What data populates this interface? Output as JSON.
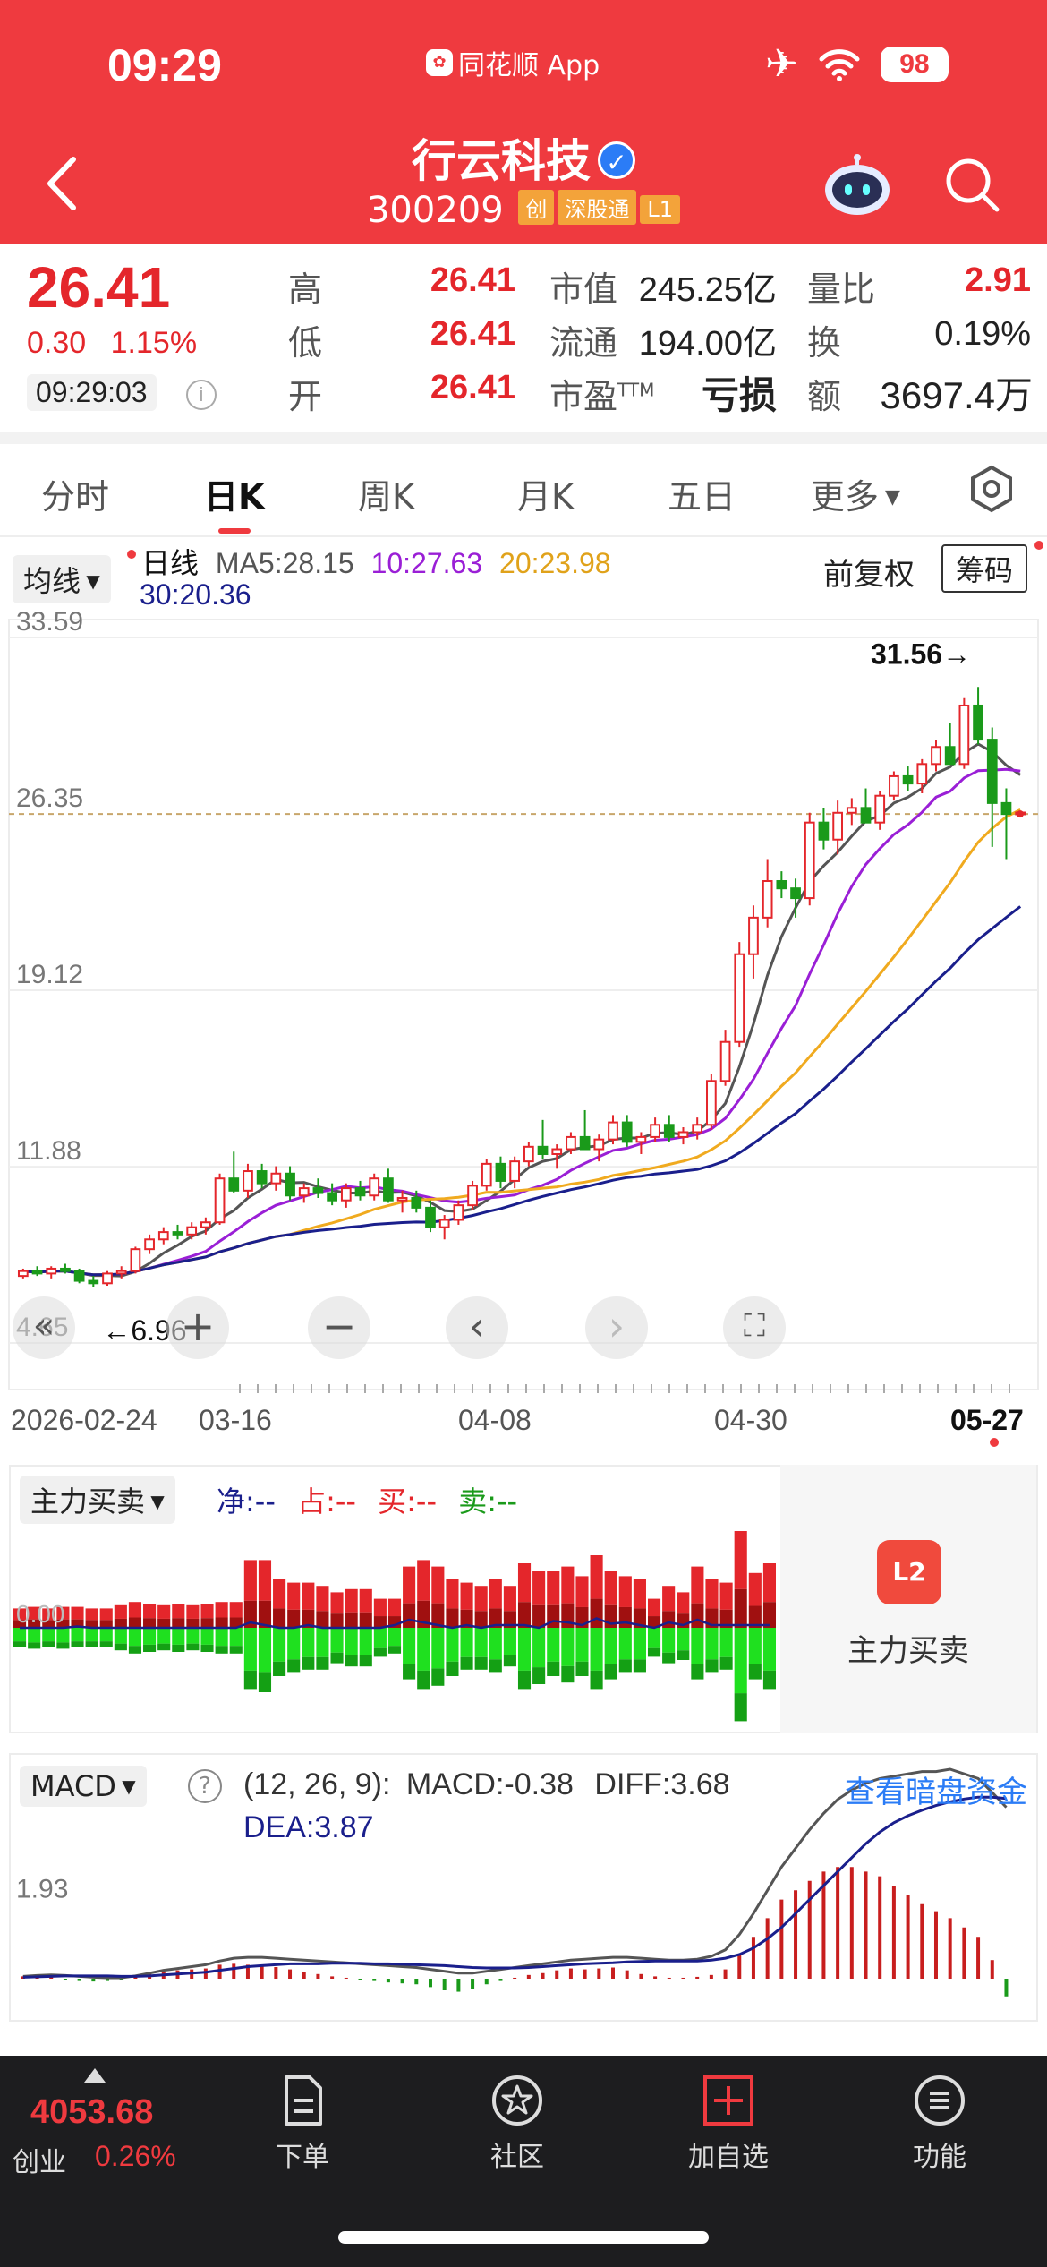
{
  "status": {
    "time": "09:29",
    "app": "同花顺 App",
    "battery": "98"
  },
  "stock": {
    "name": "行云科技",
    "code": "300209",
    "tags": [
      "创",
      "深股通",
      "L1"
    ]
  },
  "quote": {
    "price": "26.41",
    "change": "0.30",
    "pct": "1.15%",
    "time": "09:29:03",
    "rows": [
      {
        "l1": "高",
        "v1": "26.41",
        "l2": "市值",
        "v2": "245.25亿",
        "l3": "量比",
        "v3": "2.91"
      },
      {
        "l1": "低",
        "v1": "26.41",
        "l2": "流通",
        "v2": "194.00亿",
        "l3": "换",
        "v3": "0.19%"
      },
      {
        "l1": "开",
        "v1": "26.41",
        "l2": "市盈",
        "v2": "亏损",
        "l3": "额",
        "v3": "3697.4万"
      }
    ],
    "pe_sup": "TTM"
  },
  "tabs": [
    "分时",
    "日K",
    "周K",
    "月K",
    "五日",
    "更多"
  ],
  "ma": {
    "button": "均线",
    "period": "日线",
    "ma5": "MA5:28.15",
    "ma10": "10:27.63",
    "ma20": "20:23.98",
    "ma30": "30:20.36",
    "adjust": "前复权",
    "chips": "筹码"
  },
  "colors": {
    "up": "#e4262b",
    "down": "#1a9a1a",
    "ma5": "#555555",
    "ma10": "#9a1fd6",
    "ma20": "#f0aa1f",
    "ma30": "#1a1f8c",
    "brand": "#ef3a3f"
  },
  "chart_data": [
    {
      "type": "candlestick",
      "title": "",
      "y_ticks": [
        "33.59",
        "26.35",
        "19.12",
        "11.88",
        "4.65"
      ],
      "ylim": [
        4.65,
        33.59
      ],
      "current_price": 26.35,
      "high_marker": "31.56→",
      "low_marker": "←6.96",
      "x_labels": [
        "2026-02-24",
        "03-16",
        "04-08",
        "04-30",
        "05-27"
      ],
      "candles": [
        [
          7.4,
          7.7,
          7.3,
          7.6
        ],
        [
          7.6,
          7.8,
          7.4,
          7.5
        ],
        [
          7.5,
          7.8,
          7.3,
          7.7
        ],
        [
          7.7,
          7.9,
          7.5,
          7.6
        ],
        [
          7.6,
          7.7,
          7.1,
          7.2
        ],
        [
          7.2,
          7.4,
          6.96,
          7.1
        ],
        [
          7.1,
          7.6,
          7.0,
          7.5
        ],
        [
          7.5,
          7.8,
          7.3,
          7.6
        ],
        [
          7.6,
          8.6,
          7.5,
          8.5
        ],
        [
          8.5,
          9.1,
          8.3,
          8.9
        ],
        [
          8.9,
          9.4,
          8.7,
          9.2
        ],
        [
          9.2,
          9.5,
          8.9,
          9.1
        ],
        [
          9.1,
          9.6,
          8.9,
          9.4
        ],
        [
          9.4,
          9.8,
          9.1,
          9.6
        ],
        [
          9.6,
          11.6,
          9.5,
          11.4
        ],
        [
          11.4,
          12.5,
          10.8,
          10.9
        ],
        [
          10.9,
          12.0,
          10.6,
          11.7
        ],
        [
          11.7,
          12.0,
          11.0,
          11.2
        ],
        [
          11.2,
          11.9,
          10.9,
          11.6
        ],
        [
          11.6,
          11.9,
          10.5,
          10.7
        ],
        [
          10.7,
          11.2,
          10.4,
          11.0
        ],
        [
          11.0,
          11.4,
          10.6,
          10.8
        ],
        [
          10.8,
          11.2,
          10.3,
          10.5
        ],
        [
          10.5,
          11.2,
          10.2,
          11.0
        ],
        [
          11.0,
          11.3,
          10.5,
          10.7
        ],
        [
          10.7,
          11.6,
          10.5,
          11.4
        ],
        [
          11.4,
          11.8,
          10.4,
          10.5
        ],
        [
          10.5,
          10.9,
          10.0,
          10.6
        ],
        [
          10.6,
          10.9,
          10.0,
          10.2
        ],
        [
          10.2,
          10.5,
          9.2,
          9.4
        ],
        [
          9.4,
          9.9,
          8.9,
          9.7
        ],
        [
          9.7,
          10.5,
          9.5,
          10.3
        ],
        [
          10.3,
          11.3,
          10.1,
          11.1
        ],
        [
          11.1,
          12.2,
          10.9,
          12.0
        ],
        [
          12.0,
          12.3,
          11.0,
          11.3
        ],
        [
          11.3,
          12.3,
          11.0,
          12.1
        ],
        [
          12.1,
          12.9,
          11.9,
          12.7
        ],
        [
          12.7,
          13.8,
          12.2,
          12.4
        ],
        [
          12.4,
          12.8,
          11.8,
          12.6
        ],
        [
          12.6,
          13.3,
          12.4,
          13.1
        ],
        [
          13.1,
          14.2,
          12.8,
          12.6
        ],
        [
          12.6,
          13.2,
          12.1,
          13.0
        ],
        [
          13.0,
          14.0,
          12.8,
          13.7
        ],
        [
          13.7,
          14.0,
          12.7,
          12.9
        ],
        [
          12.9,
          13.3,
          12.4,
          13.1
        ],
        [
          13.1,
          13.9,
          12.9,
          13.6
        ],
        [
          13.6,
          14.0,
          12.9,
          13.1
        ],
        [
          13.1,
          13.5,
          12.8,
          13.3
        ],
        [
          13.3,
          13.9,
          13.0,
          13.6
        ],
        [
          13.6,
          15.7,
          13.4,
          15.4
        ],
        [
          15.4,
          17.5,
          15.2,
          17.0
        ],
        [
          17.0,
          21.1,
          16.8,
          20.6
        ],
        [
          20.6,
          22.6,
          19.6,
          22.1
        ],
        [
          22.1,
          24.5,
          21.7,
          23.6
        ],
        [
          23.6,
          24.0,
          22.9,
          23.3
        ],
        [
          23.3,
          23.7,
          22.1,
          22.9
        ],
        [
          22.9,
          26.4,
          22.6,
          26.0
        ],
        [
          26.0,
          26.6,
          24.9,
          25.3
        ],
        [
          25.3,
          26.9,
          24.7,
          26.4
        ],
        [
          26.4,
          27.0,
          25.9,
          26.6
        ],
        [
          26.6,
          27.4,
          26.1,
          26.0
        ],
        [
          26.0,
          27.3,
          25.7,
          27.1
        ],
        [
          27.1,
          28.1,
          26.9,
          27.9
        ],
        [
          27.9,
          28.3,
          27.3,
          27.6
        ],
        [
          27.6,
          28.6,
          27.2,
          28.4
        ],
        [
          28.4,
          29.4,
          28.1,
          29.1
        ],
        [
          29.1,
          30.1,
          28.4,
          28.4
        ],
        [
          28.4,
          31.1,
          28.2,
          30.8
        ],
        [
          30.8,
          31.56,
          29.2,
          29.4
        ],
        [
          29.4,
          29.9,
          25.0,
          26.8
        ],
        [
          26.8,
          27.4,
          24.5,
          26.35
        ],
        [
          26.35,
          26.41,
          26.35,
          26.41
        ]
      ]
    },
    {
      "type": "bar",
      "title": "主力买卖",
      "legend": [
        "净:--",
        "占:--",
        "买:--",
        "卖:--"
      ],
      "baseline_label": "0.00",
      "buy": [
        12,
        13,
        12,
        13,
        13,
        12,
        12,
        14,
        16,
        15,
        14,
        15,
        14,
        15,
        16,
        16,
        42,
        42,
        30,
        28,
        28,
        26,
        22,
        24,
        24,
        18,
        18,
        38,
        42,
        38,
        30,
        28,
        26,
        30,
        26,
        40,
        35,
        35,
        38,
        32,
        45,
        35,
        32,
        30,
        18,
        26,
        22,
        38,
        30,
        28,
        60,
        34,
        40
      ],
      "sell": [
        12,
        13,
        12,
        13,
        12,
        12,
        12,
        14,
        16,
        15,
        14,
        15,
        14,
        15,
        16,
        16,
        38,
        40,
        30,
        28,
        26,
        26,
        22,
        24,
        24,
        18,
        16,
        32,
        38,
        36,
        30,
        26,
        26,
        28,
        24,
        38,
        35,
        30,
        34,
        30,
        38,
        32,
        28,
        28,
        18,
        22,
        20,
        32,
        28,
        26,
        58,
        32,
        38
      ]
    },
    {
      "type": "bar",
      "title": "MACD",
      "params": "(12, 26, 9):",
      "macd_label": "MACD:-0.38",
      "diff_label": "DIFF:3.68",
      "dea_label": "DEA:3.87",
      "y_tick": "1.93",
      "macd": [
        0.05,
        0.04,
        0.03,
        -0.02,
        -0.05,
        -0.06,
        -0.05,
        -0.02,
        0.05,
        0.1,
        0.15,
        0.18,
        0.2,
        0.22,
        0.3,
        0.32,
        0.3,
        0.28,
        0.25,
        0.2,
        0.15,
        0.1,
        0.05,
        0.02,
        -0.02,
        -0.05,
        -0.08,
        -0.1,
        -0.12,
        -0.18,
        -0.25,
        -0.28,
        -0.22,
        -0.12,
        -0.05,
        0.02,
        0.08,
        0.12,
        0.18,
        0.22,
        0.2,
        0.22,
        0.24,
        0.18,
        0.1,
        0.05,
        0.02,
        0.02,
        0.04,
        0.08,
        0.2,
        0.5,
        0.9,
        1.3,
        1.7,
        1.9,
        2.1,
        2.3,
        2.4,
        2.4,
        2.3,
        2.2,
        2.0,
        1.8,
        1.6,
        1.45,
        1.3,
        1.1,
        0.9,
        0.4,
        -0.38
      ],
      "diff": [
        0.05,
        0.07,
        0.08,
        0.07,
        0.05,
        0.03,
        0.02,
        0.02,
        0.06,
        0.12,
        0.18,
        0.22,
        0.26,
        0.3,
        0.38,
        0.44,
        0.46,
        0.46,
        0.44,
        0.42,
        0.4,
        0.38,
        0.36,
        0.34,
        0.32,
        0.3,
        0.28,
        0.26,
        0.24,
        0.2,
        0.16,
        0.12,
        0.12,
        0.16,
        0.2,
        0.24,
        0.28,
        0.32,
        0.36,
        0.4,
        0.42,
        0.44,
        0.46,
        0.46,
        0.44,
        0.42,
        0.4,
        0.4,
        0.42,
        0.48,
        0.62,
        0.95,
        1.4,
        1.9,
        2.4,
        2.8,
        3.2,
        3.55,
        3.85,
        4.05,
        4.2,
        4.3,
        4.35,
        4.4,
        4.45,
        4.45,
        4.5,
        4.4,
        4.3,
        4.0,
        3.68
      ],
      "dea": [
        0.03,
        0.04,
        0.05,
        0.06,
        0.06,
        0.06,
        0.06,
        0.05,
        0.05,
        0.06,
        0.08,
        0.1,
        0.12,
        0.14,
        0.18,
        0.22,
        0.26,
        0.28,
        0.3,
        0.32,
        0.32,
        0.32,
        0.33,
        0.33,
        0.33,
        0.32,
        0.32,
        0.31,
        0.3,
        0.29,
        0.28,
        0.26,
        0.24,
        0.23,
        0.23,
        0.23,
        0.24,
        0.26,
        0.28,
        0.3,
        0.32,
        0.33,
        0.34,
        0.36,
        0.37,
        0.38,
        0.38,
        0.38,
        0.38,
        0.4,
        0.44,
        0.52,
        0.66,
        0.86,
        1.1,
        1.4,
        1.7,
        2.0,
        2.3,
        2.6,
        2.9,
        3.15,
        3.35,
        3.5,
        3.62,
        3.72,
        3.8,
        3.86,
        3.9,
        3.9,
        3.87
      ]
    }
  ],
  "fund_flow": {
    "button": "主力买卖",
    "side_icon": "L2",
    "side_label": "主力买卖"
  },
  "macd_panel": {
    "button": "MACD",
    "dark_pool": "查看暗盘资金"
  },
  "bottom": {
    "index_value": "4053.68",
    "index_name": "创业",
    "index_pct": "0.26%",
    "nav": [
      {
        "label": "下单",
        "icon": "order-icon"
      },
      {
        "label": "社区",
        "icon": "community-icon"
      },
      {
        "label": "加自选",
        "icon": "add-watchlist-icon"
      },
      {
        "label": "功能",
        "icon": "menu-icon"
      }
    ]
  }
}
